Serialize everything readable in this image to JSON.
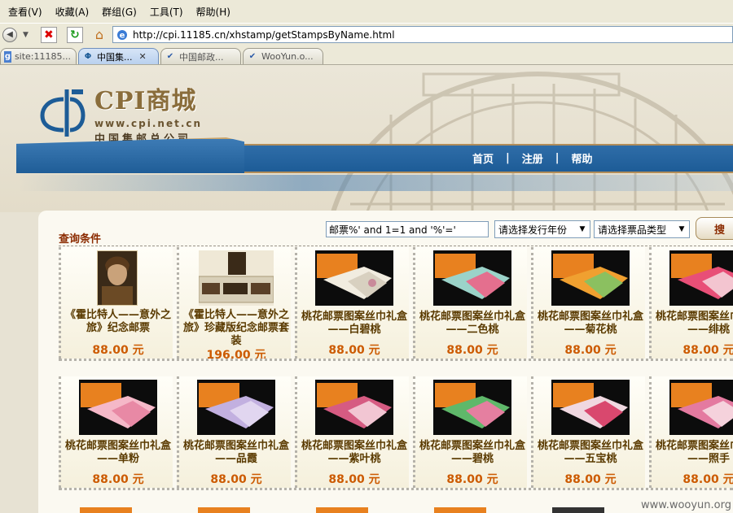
{
  "menu": [
    "查看(V)",
    "收藏(A)",
    "群组(G)",
    "工具(T)",
    "帮助(H)"
  ],
  "address": {
    "url": "http://cpi.11185.cn/xhstamp/getStampsByName.html"
  },
  "tabs": [
    {
      "label": "site:11185...",
      "icon": "google-icon"
    },
    {
      "label": "中国集...",
      "icon": "cpi-icon",
      "active": true
    },
    {
      "label": "中国邮政...",
      "icon": "check-icon"
    },
    {
      "label": "WooYun.o...",
      "icon": "check-icon"
    }
  ],
  "logo": {
    "title": "CPI商城",
    "url": "www.cpi.net.cn",
    "company": "中国集邮总公司"
  },
  "nav": {
    "home": "首页",
    "sep": "|",
    "register": "注册",
    "help": "帮助"
  },
  "query": {
    "label": "查询条件",
    "value": "邮票%' and 1=1 and '%'='",
    "year_select": "请选择发行年份",
    "type_select": "请选择票品类型",
    "search_button": "搜"
  },
  "products": [
    {
      "name": "《霍比特人——意外之旅》纪念邮票",
      "price": "88.00 元"
    },
    {
      "name": "《霍比特人——意外之旅》珍藏版纪念邮票套装",
      "price": "196.00 元"
    },
    {
      "name": "桃花邮票图案丝巾礼盒——白碧桃",
      "price": "88.00 元"
    },
    {
      "name": "桃花邮票图案丝巾礼盒——二色桃",
      "price": "88.00 元"
    },
    {
      "name": "桃花邮票图案丝巾礼盒——菊花桃",
      "price": "88.00 元"
    },
    {
      "name": "桃花邮票图案丝巾礼盒——绯桃",
      "price": "88.00 元"
    },
    {
      "name": "桃花邮票图案丝巾礼盒——单粉",
      "price": "88.00 元"
    },
    {
      "name": "桃花邮票图案丝巾礼盒——品霞",
      "price": "88.00 元"
    },
    {
      "name": "桃花邮票图案丝巾礼盒——紫叶桃",
      "price": "88.00 元"
    },
    {
      "name": "桃花邮票图案丝巾礼盒——碧桃",
      "price": "88.00 元"
    },
    {
      "name": "桃花邮票图案丝巾礼盒——五宝桃",
      "price": "88.00 元"
    },
    {
      "name": "桃花邮票图案丝巾礼盒——照手",
      "price": "88.00 元"
    }
  ],
  "watermark": "www.wooyun.org",
  "colors": {
    "nav_blue": "#1d5c97",
    "price_orange": "#cc5a00",
    "label_red": "#8b2b00"
  }
}
